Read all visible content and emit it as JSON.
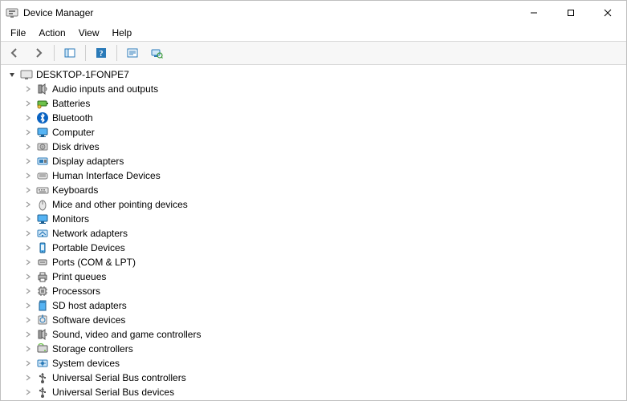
{
  "window": {
    "title": "Device Manager"
  },
  "menu": {
    "items": [
      "File",
      "Action",
      "View",
      "Help"
    ]
  },
  "tree": {
    "root": {
      "label": "DESKTOP-1FONPE7",
      "expanded": true
    },
    "categories": [
      {
        "label": "Audio inputs and outputs",
        "icon": "speaker"
      },
      {
        "label": "Batteries",
        "icon": "battery"
      },
      {
        "label": "Bluetooth",
        "icon": "bluetooth"
      },
      {
        "label": "Computer",
        "icon": "monitor"
      },
      {
        "label": "Disk drives",
        "icon": "disk"
      },
      {
        "label": "Display adapters",
        "icon": "display-card"
      },
      {
        "label": "Human Interface Devices",
        "icon": "hid"
      },
      {
        "label": "Keyboards",
        "icon": "keyboard"
      },
      {
        "label": "Mice and other pointing devices",
        "icon": "mouse"
      },
      {
        "label": "Monitors",
        "icon": "monitor"
      },
      {
        "label": "Network adapters",
        "icon": "network"
      },
      {
        "label": "Portable Devices",
        "icon": "portable"
      },
      {
        "label": "Ports (COM & LPT)",
        "icon": "port"
      },
      {
        "label": "Print queues",
        "icon": "printer"
      },
      {
        "label": "Processors",
        "icon": "cpu"
      },
      {
        "label": "SD host adapters",
        "icon": "sdcard"
      },
      {
        "label": "Software devices",
        "icon": "software"
      },
      {
        "label": "Sound, video and game controllers",
        "icon": "speaker"
      },
      {
        "label": "Storage controllers",
        "icon": "storage"
      },
      {
        "label": "System devices",
        "icon": "system"
      },
      {
        "label": "Universal Serial Bus controllers",
        "icon": "usb"
      },
      {
        "label": "Universal Serial Bus devices",
        "icon": "usb"
      }
    ]
  }
}
